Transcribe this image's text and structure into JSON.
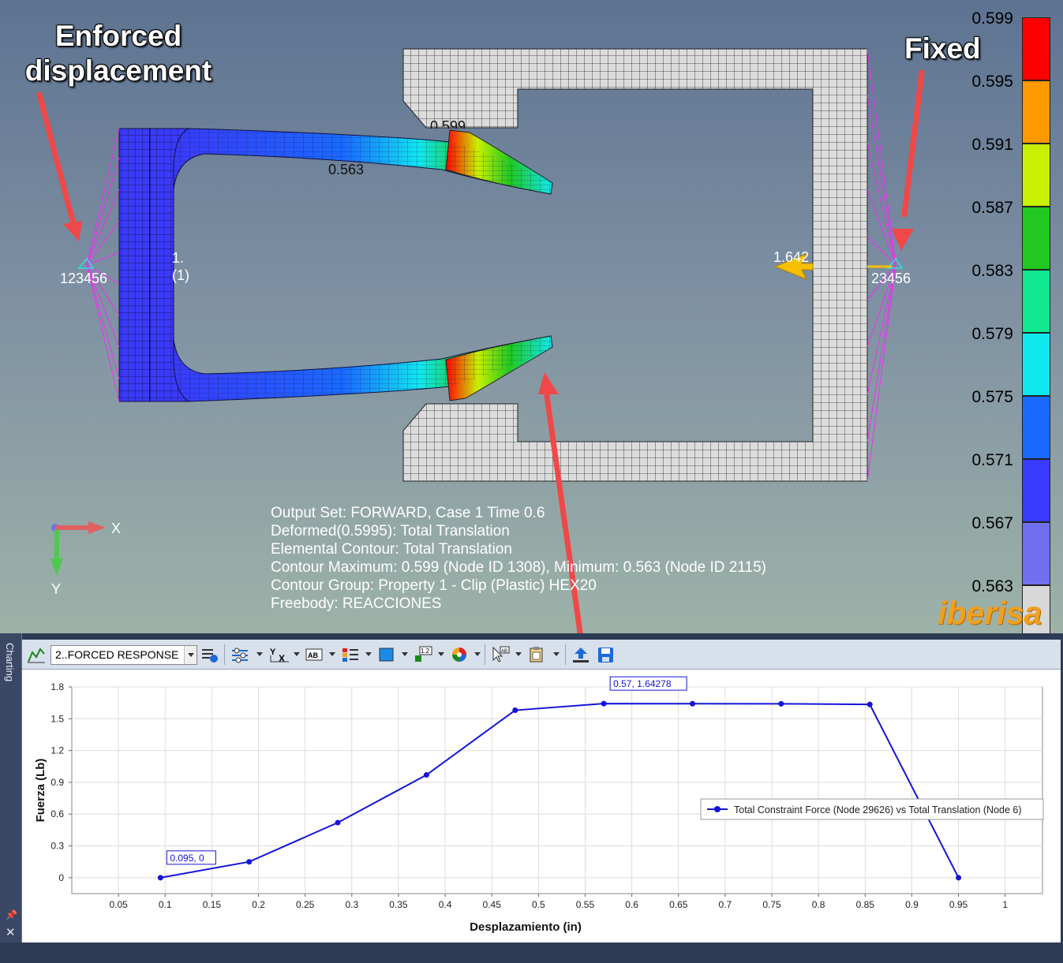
{
  "viewport": {
    "annotations": {
      "enforced": "Enforced\ndisplacement",
      "fixed": "Fixed"
    },
    "labels": {
      "left_constraint": "123456",
      "right_constraint": "23456",
      "inner_label_1": "1.",
      "inner_label_2": "(1)",
      "force_value": "1.642",
      "min_marker": "0.563",
      "top_marker": "0.599"
    },
    "axes": {
      "x": "X",
      "y": "Y"
    },
    "info_lines": [
      "Output Set: FORWARD, Case 1 Time 0.6",
      "Deformed(0.5995): Total Translation",
      "Elemental Contour: Total Translation",
      "Contour Maximum: 0.599 (Node ID 1308), Minimum: 0.563 (Node ID 2115)",
      "Contour Group: Property 1 - Clip (Plastic) HEX20",
      "Freebody: REACCIONES"
    ],
    "legend": {
      "labels": [
        "0.599",
        "0.595",
        "0.591",
        "0.587",
        "0.583",
        "0.579",
        "0.575",
        "0.571",
        "0.567",
        "0.563"
      ],
      "colors": [
        "#ff0000",
        "#ff9900",
        "#c8f000",
        "#20c820",
        "#10e890",
        "#10e8f0",
        "#1a6aff",
        "#3a3aff",
        "#7070f0",
        "#d8d8d8"
      ]
    },
    "brand": "iberisa"
  },
  "panel": {
    "side_tab": "Charting",
    "toolbar": {
      "chart_select": "2..FORCED RESPONSE"
    }
  },
  "chart_data": {
    "type": "line",
    "xlabel": "Desplazamiento (in)",
    "ylabel": "Fuerza (Lb)",
    "xlim": [
      0,
      1.04
    ],
    "ylim": [
      -0.15,
      1.8
    ],
    "xticks": [
      "0.05",
      "0.1",
      "0.15",
      "0.2",
      "0.25",
      "0.3",
      "0.35",
      "0.4",
      "0.45",
      "0.5",
      "0.55",
      "0.6",
      "0.65",
      "0.7",
      "0.75",
      "0.8",
      "0.85",
      "0.9",
      "0.95",
      "1"
    ],
    "yticks": [
      "0",
      "0.3",
      "0.6",
      "0.9",
      "1.2",
      "1.5",
      "1.8"
    ],
    "grid": true,
    "legend_position": "right",
    "series": [
      {
        "name": "Total Constraint Force (Node 29626) vs Total Translation (Node 6)",
        "color": "#1414d8",
        "x": [
          0.095,
          0.19,
          0.285,
          0.38,
          0.475,
          0.57,
          0.665,
          0.76,
          0.855,
          0.95
        ],
        "y": [
          0,
          0.15,
          0.52,
          0.97,
          1.58,
          1.64278,
          1.642,
          1.641,
          1.635,
          0
        ]
      }
    ],
    "annotations": [
      {
        "x": 0.095,
        "y": 0,
        "text": "0.095, 0"
      },
      {
        "x": 0.57,
        "y": 1.64278,
        "text": "0.57, 1.64278"
      }
    ]
  }
}
